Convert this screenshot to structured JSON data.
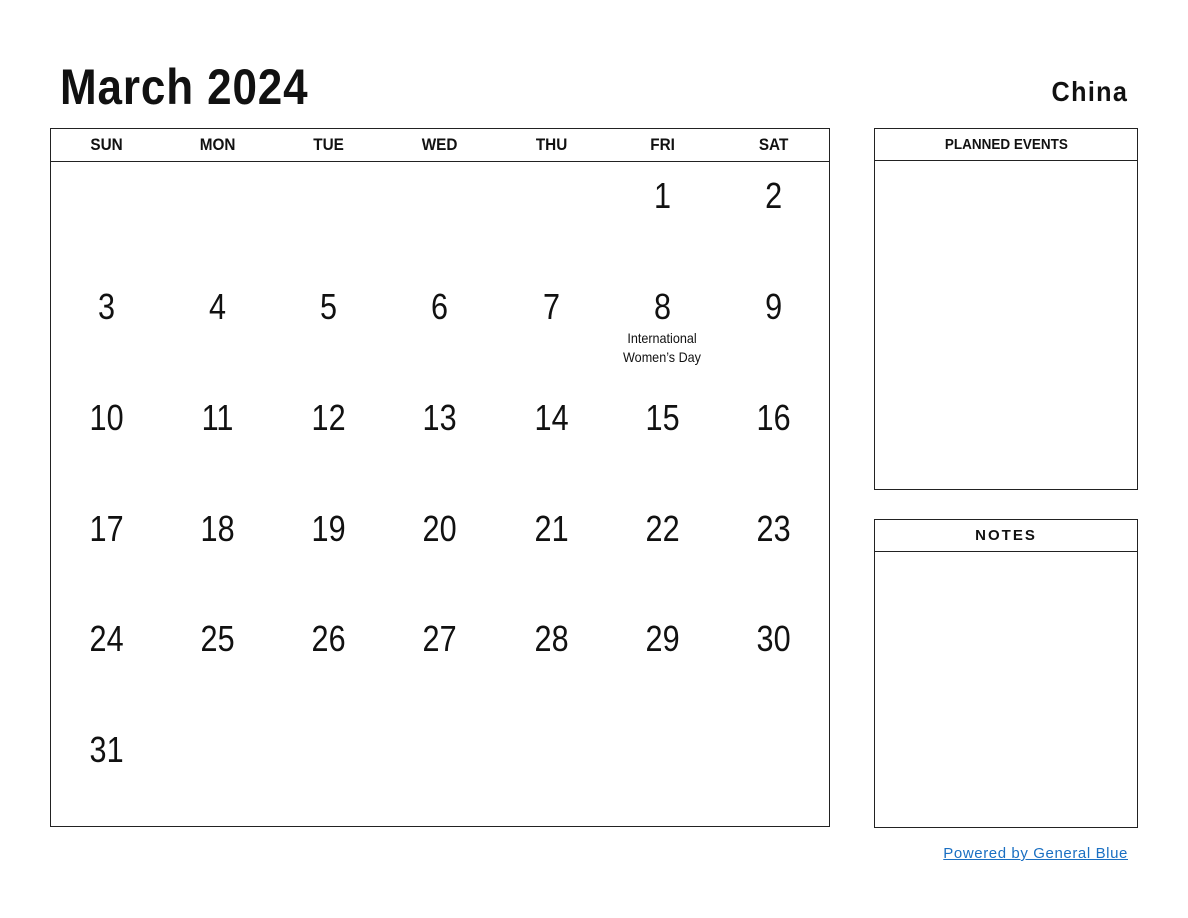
{
  "header": {
    "title": "March 2024",
    "country": "China"
  },
  "calendar": {
    "weekdays": [
      "SUN",
      "MON",
      "TUE",
      "WED",
      "THU",
      "FRI",
      "SAT"
    ],
    "cells": [
      {
        "day": "",
        "event": ""
      },
      {
        "day": "",
        "event": ""
      },
      {
        "day": "",
        "event": ""
      },
      {
        "day": "",
        "event": ""
      },
      {
        "day": "",
        "event": ""
      },
      {
        "day": "1",
        "event": ""
      },
      {
        "day": "2",
        "event": ""
      },
      {
        "day": "3",
        "event": ""
      },
      {
        "day": "4",
        "event": ""
      },
      {
        "day": "5",
        "event": ""
      },
      {
        "day": "6",
        "event": ""
      },
      {
        "day": "7",
        "event": ""
      },
      {
        "day": "8",
        "event": "International Women’s Day"
      },
      {
        "day": "9",
        "event": ""
      },
      {
        "day": "10",
        "event": ""
      },
      {
        "day": "11",
        "event": ""
      },
      {
        "day": "12",
        "event": ""
      },
      {
        "day": "13",
        "event": ""
      },
      {
        "day": "14",
        "event": ""
      },
      {
        "day": "15",
        "event": ""
      },
      {
        "day": "16",
        "event": ""
      },
      {
        "day": "17",
        "event": ""
      },
      {
        "day": "18",
        "event": ""
      },
      {
        "day": "19",
        "event": ""
      },
      {
        "day": "20",
        "event": ""
      },
      {
        "day": "21",
        "event": ""
      },
      {
        "day": "22",
        "event": ""
      },
      {
        "day": "23",
        "event": ""
      },
      {
        "day": "24",
        "event": ""
      },
      {
        "day": "25",
        "event": ""
      },
      {
        "day": "26",
        "event": ""
      },
      {
        "day": "27",
        "event": ""
      },
      {
        "day": "28",
        "event": ""
      },
      {
        "day": "29",
        "event": ""
      },
      {
        "day": "30",
        "event": ""
      },
      {
        "day": "31",
        "event": ""
      },
      {
        "day": "",
        "event": ""
      },
      {
        "day": "",
        "event": ""
      },
      {
        "day": "",
        "event": ""
      },
      {
        "day": "",
        "event": ""
      },
      {
        "day": "",
        "event": ""
      },
      {
        "day": "",
        "event": ""
      }
    ]
  },
  "panels": {
    "planned_events": "PLANNED EVENTS",
    "notes": "NOTES"
  },
  "footer": {
    "link": "Powered by General Blue",
    "color": "#1a6fc2"
  }
}
